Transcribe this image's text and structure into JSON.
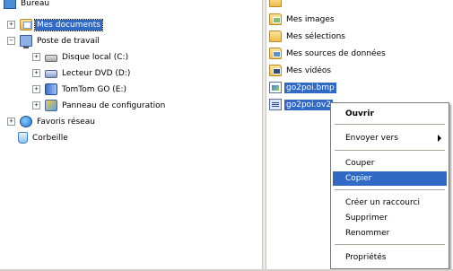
{
  "tree": {
    "items": [
      {
        "label": "Bureau",
        "expander": "",
        "icon": "desktop-icon"
      },
      {
        "label": "Mes documents",
        "expander": "+",
        "icon": "my-documents-icon"
      },
      {
        "label": "Poste de travail",
        "expander": "−",
        "icon": "computer-icon"
      },
      {
        "label": "Disque local (C:)",
        "expander": "+",
        "icon": "local-disk-icon"
      },
      {
        "label": "Lecteur DVD (D:)",
        "expander": "+",
        "icon": "dvd-drive-icon"
      },
      {
        "label": "TomTom GO (E:)",
        "expander": "+",
        "icon": "tomtom-drive-icon"
      },
      {
        "label": "Panneau de configuration",
        "expander": "+",
        "icon": "control-panel-icon"
      },
      {
        "label": "Favoris réseau",
        "expander": "+",
        "icon": "network-places-icon"
      },
      {
        "label": "Corbeille",
        "expander": "",
        "icon": "recycle-bin-icon"
      }
    ]
  },
  "files": {
    "items": [
      {
        "label": "Mes images",
        "icon": "my-pictures-folder-icon"
      },
      {
        "label": "Mes sélections",
        "icon": "folder-icon"
      },
      {
        "label": "Mes sources de données",
        "icon": "data-sources-folder-icon"
      },
      {
        "label": "Mes vidéos",
        "icon": "my-videos-folder-icon"
      },
      {
        "label": "go2poi.bmp",
        "icon": "bmp-file-icon"
      },
      {
        "label": "go2poi.ov2",
        "icon": "ov2-file-icon"
      }
    ]
  },
  "context_menu": {
    "open": "Ouvrir",
    "send_to": "Envoyer vers",
    "cut": "Couper",
    "copy": "Copier",
    "create_shortcut": "Créer un raccourci",
    "delete": "Supprimer",
    "rename": "Renommer",
    "properties": "Propriétés"
  },
  "colors": {
    "selection": "#316ac5",
    "window_bg": "#ffffff",
    "separator": "#ece9d8"
  }
}
